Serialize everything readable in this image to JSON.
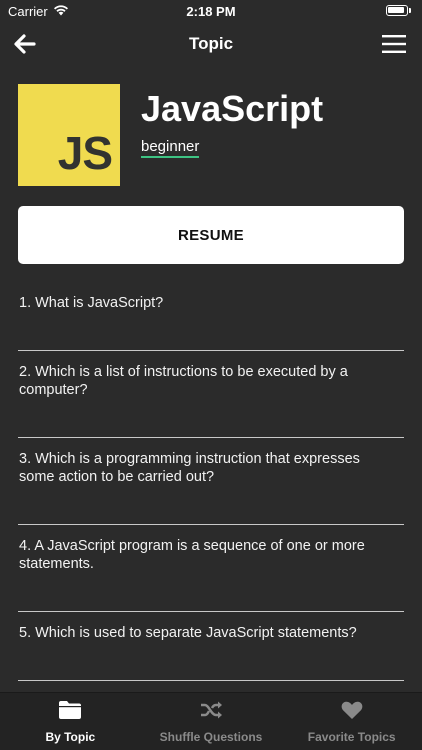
{
  "status_bar": {
    "carrier": "Carrier",
    "time": "2:18 PM"
  },
  "nav": {
    "title": "Topic",
    "back_icon": "arrow-left-icon",
    "menu_icon": "hamburger-menu-icon"
  },
  "topic": {
    "logo_text": "JS",
    "logo_color": "#f0db4f",
    "name": "JavaScript",
    "level": "beginner",
    "level_underline_color": "#3ec383"
  },
  "resume_label": "RESUME",
  "questions": [
    "1. What is JavaScript?",
    "2. Which is a list of instructions to be executed by a computer?",
    "3. Which is a programming instruction that expresses some action to be carried out?",
    "4. A JavaScript program is a sequence of one or more statements.",
    "5. Which is used to separate JavaScript statements?"
  ],
  "tabs": [
    {
      "label": "By Topic",
      "icon": "folder-icon",
      "active": true
    },
    {
      "label": "Shuffle Questions",
      "icon": "shuffle-icon",
      "active": false
    },
    {
      "label": "Favorite Topics",
      "icon": "heart-icon",
      "active": false
    }
  ]
}
